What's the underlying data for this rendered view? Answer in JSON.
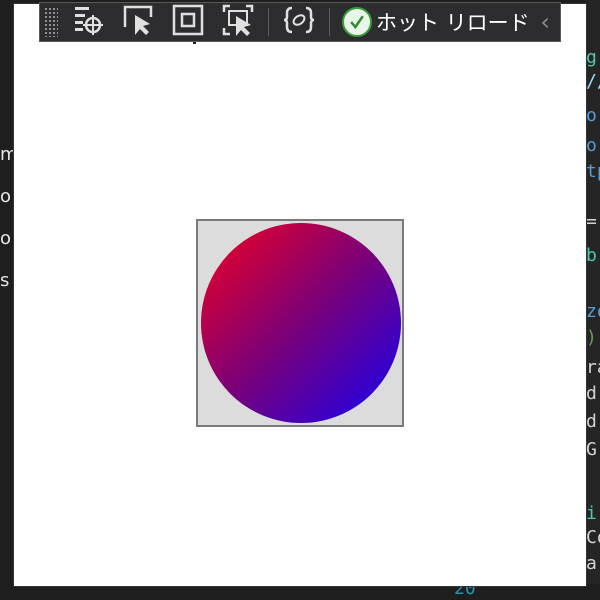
{
  "window": {
    "title_fragment": "Te"
  },
  "toolbar": {
    "buttons": [
      {
        "name": "select-element-icon"
      },
      {
        "name": "select-element-cursor-icon"
      },
      {
        "name": "display-layout-adorners-icon"
      },
      {
        "name": "track-focused-element-icon"
      },
      {
        "name": "binding-failures-icon"
      }
    ],
    "hot_reload_label": "ホット リロード"
  },
  "ide_left_fragments": [
    "m",
    "o",
    "o",
    "s"
  ],
  "ide_right_fragments": [
    "g",
    "//",
    "o",
    "o",
    "tp",
    "=",
    "b",
    "zo",
    ")",
    "ra",
    "d",
    "d",
    "G",
    "i",
    "Co",
    "a"
  ],
  "ide_bottom_number": "20",
  "colors": {
    "gradient_start": "#f2001e",
    "gradient_end": "#1400f5",
    "box_background": "#dcdcdc",
    "toolbar_background": "#2d2d30",
    "hot_reload_check": "#3a9d3a"
  }
}
